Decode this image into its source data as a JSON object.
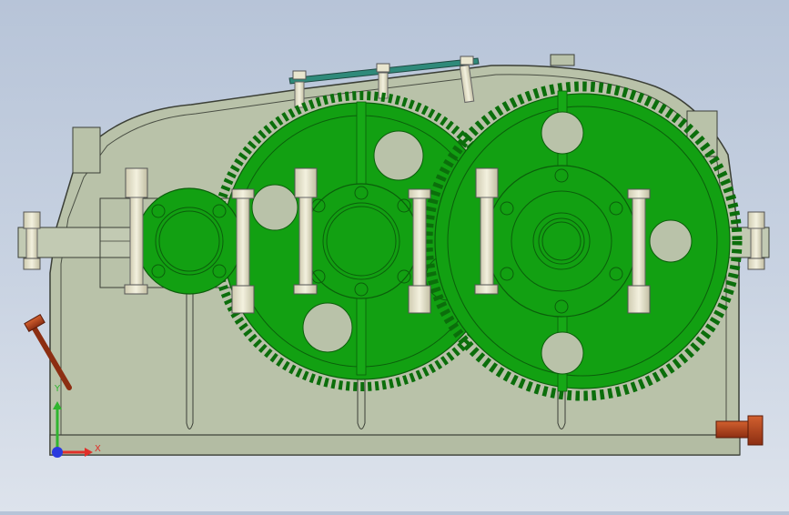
{
  "viewport": {
    "background_top": "#b7c4d8",
    "background_bottom": "#dde3ec"
  },
  "model": {
    "housing_color": "#b9c2a9",
    "housing_edge": "#3b3f36",
    "gear_color": "#12a012",
    "gear_dark": "#0b6e0b",
    "bolt_color": "#e9e6cf",
    "plug_color": "#b8451f",
    "cover_color": "#2f8a7a"
  },
  "triad": {
    "x_label": "X",
    "y_label": "Y",
    "x_color": "#e0302a",
    "y_color": "#2fb52f",
    "z_color": "#2a3adf"
  }
}
